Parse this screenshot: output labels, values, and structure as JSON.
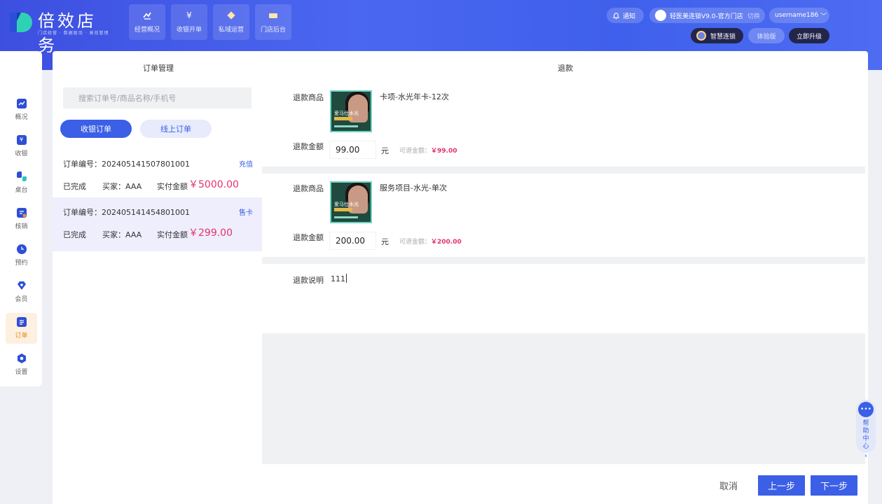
{
  "brand": {
    "name": "倍效店务",
    "tagline": "门店经营 · 数据驱动 · 高效管理"
  },
  "topnav": [
    {
      "label": "经营概况",
      "icon": "trend-icon"
    },
    {
      "label": "收银开单",
      "icon": "yen-icon"
    },
    {
      "label": "私域运营",
      "icon": "diamond-icon"
    },
    {
      "label": "门店后台",
      "icon": "store-icon"
    }
  ],
  "header": {
    "notice": "通知",
    "store": "轻医美连锁V9.0-官方门店",
    "switch": "切换",
    "username": "username186",
    "smart_chain": "智慧连锁",
    "trial": "体验版",
    "upgrade": "立即升级"
  },
  "sidebar": [
    {
      "label": "概况",
      "icon": "chart-icon",
      "active": false
    },
    {
      "label": "收银",
      "icon": "yen-icon",
      "active": false
    },
    {
      "label": "桌台",
      "icon": "table-icon",
      "active": false
    },
    {
      "label": "核销",
      "icon": "verify-icon",
      "active": false
    },
    {
      "label": "预约",
      "icon": "clock-icon",
      "active": false
    },
    {
      "label": "会员",
      "icon": "gem-icon",
      "active": false
    },
    {
      "label": "订单",
      "icon": "order-icon",
      "active": true
    },
    {
      "label": "设置",
      "icon": "settings-icon",
      "active": false
    }
  ],
  "order_panel": {
    "title": "订单管理",
    "search_placeholder": "搜索订单号/商品名称/手机号",
    "tab_cashier": "收银订单",
    "tab_online": "线上订单",
    "orders": [
      {
        "number": "订单编号：202405141507801001",
        "type": "充值",
        "status": "已完成",
        "buyer": "买家：AAA",
        "paid_label": "实付金额",
        "amount": "￥5000.00",
        "selected": false
      },
      {
        "number": "订单编号：202405141454801001",
        "type": "售卡",
        "status": "已完成",
        "buyer": "买家：AAA",
        "paid_label": "实付金额",
        "amount": "￥299.00",
        "selected": true
      }
    ]
  },
  "refund": {
    "title": "退款",
    "goods_label": "退款商品",
    "amount_label": "退款金额",
    "yuan": "元",
    "refundable_label": "可退金额：",
    "desc_label": "退款说明",
    "desc_value": "111",
    "items": [
      {
        "name": "卡项-水光年卡-12次",
        "amount": "99.00",
        "refundable": "￥99.00",
        "thumb_text": "爱马仕水光"
      },
      {
        "name": "服务项目-水光-单次",
        "amount": "200.00",
        "refundable": "￥200.00",
        "thumb_text": "爱马仕水光"
      }
    ]
  },
  "footer": {
    "cancel": "取消",
    "prev": "上一步",
    "next": "下一步"
  },
  "help": {
    "label": "帮助中心"
  },
  "colors": {
    "primary": "#3b5fe6",
    "amount": "#e6306e",
    "header_gradient_start": "#3d4fe0"
  }
}
